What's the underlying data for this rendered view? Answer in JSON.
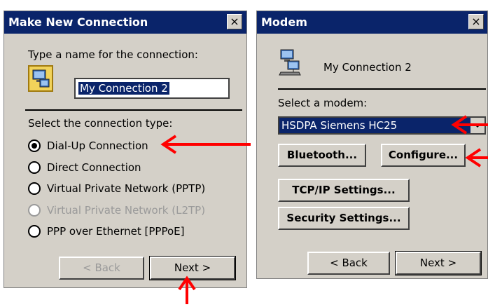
{
  "left_dialog": {
    "title": "Make New Connection",
    "close": "×",
    "name_prompt": "Type a name for the connection:",
    "name_value": "My Connection 2",
    "type_prompt": "Select the connection type:",
    "options": [
      {
        "label": "Dial-Up Connection",
        "selected": true,
        "enabled": true
      },
      {
        "label": "Direct Connection",
        "selected": false,
        "enabled": true
      },
      {
        "label": "Virtual Private Network (PPTP)",
        "selected": false,
        "enabled": true
      },
      {
        "label": "Virtual Private Network (L2TP)",
        "selected": false,
        "enabled": false
      },
      {
        "label": "PPP over Ethernet [PPPoE]",
        "selected": false,
        "enabled": true
      }
    ],
    "back_label": "< Back",
    "next_label": "Next >"
  },
  "right_dialog": {
    "title": "Modem",
    "close": "×",
    "connection_name": "My Connection 2",
    "modem_prompt": "Select a modem:",
    "modem_value": "HSDPA Siemens HC25",
    "bluetooth_label": "Bluetooth...",
    "configure_label": "Configure...",
    "tcpip_label": "TCP/IP Settings...",
    "security_label": "Security Settings...",
    "back_label": "< Back",
    "next_label": "Next >"
  },
  "colors": {
    "titlebar": "#0a246a",
    "dialog_bg": "#d4d0c8",
    "selection": "#0a246a",
    "annotation_arrow": "#ff0000"
  },
  "icons": [
    "connection-icon",
    "modem-icon",
    "close-icon",
    "dropdown-arrow-icon",
    "annotation-arrow-icon"
  ]
}
